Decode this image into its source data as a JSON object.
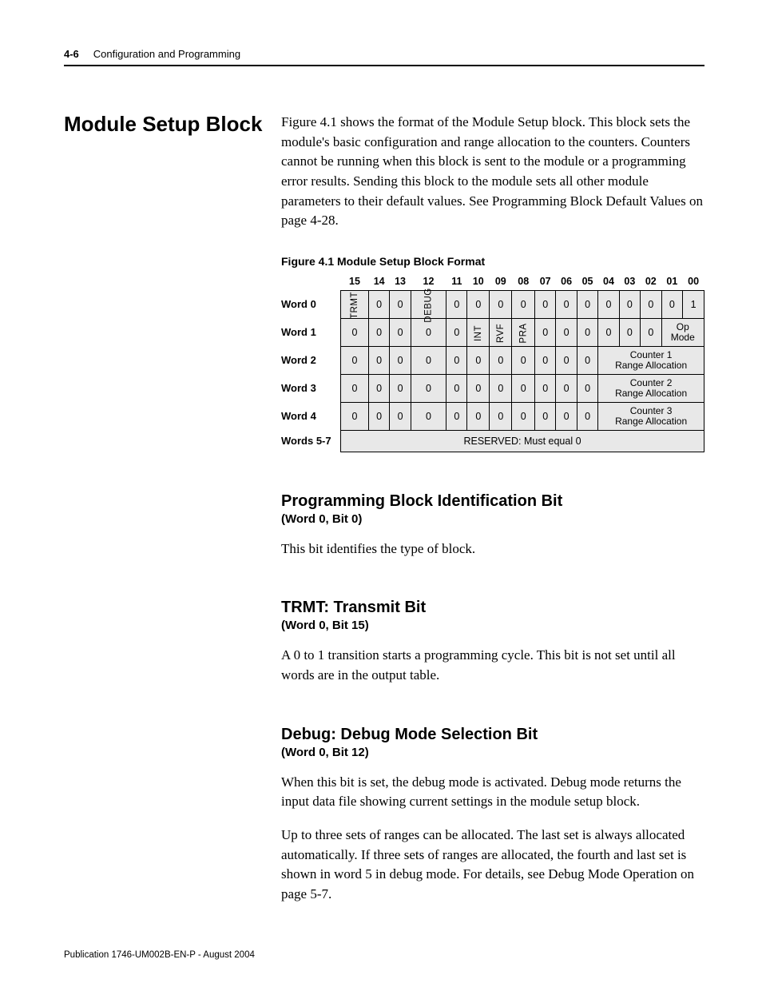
{
  "header": {
    "page_number": "4-6",
    "section_title": "Configuration and Programming"
  },
  "left_heading": "Module Setup Block",
  "intro_paragraph": "Figure 4.1 shows the format of the Module Setup block. This block sets the module's basic configuration and range allocation to the counters. Counters cannot be running when this block is sent to the module or a programming error results. Sending this block to the module sets all other module parameters to their default values. See Programming Block Default Values on page 4-28.",
  "figure_caption": "Figure 4.1 Module Setup Block Format",
  "bit_columns": [
    "15",
    "14",
    "13",
    "12",
    "11",
    "10",
    "09",
    "08",
    "07",
    "06",
    "05",
    "04",
    "03",
    "02",
    "01",
    "00"
  ],
  "rows": {
    "word0": {
      "label": "Word 0",
      "cells": [
        "TRMT",
        "0",
        "0",
        "DEBUG",
        "0",
        "0",
        "0",
        "0",
        "0",
        "0",
        "0",
        "0",
        "0",
        "0",
        "0",
        "1"
      ],
      "rotated": {
        "0": true,
        "3": true
      }
    },
    "word1": {
      "label": "Word 1",
      "cells": [
        "0",
        "0",
        "0",
        "0",
        "0",
        "INT",
        "RVF",
        "PRA",
        "0",
        "0",
        "0",
        "0",
        "0",
        "0"
      ],
      "rotated": {
        "5": true,
        "6": true,
        "7": true
      },
      "trailing_span": {
        "colspan": 2,
        "text_line1": "Op",
        "text_line2": "Mode"
      }
    },
    "word2": {
      "label": "Word 2",
      "cells": [
        "0",
        "0",
        "0",
        "0",
        "0",
        "0",
        "0",
        "0",
        "0",
        "0",
        "0"
      ],
      "trailing_span": {
        "colspan": 5,
        "text_line1": "Counter 1",
        "text_line2": "Range Allocation"
      }
    },
    "word3": {
      "label": "Word 3",
      "cells": [
        "0",
        "0",
        "0",
        "0",
        "0",
        "0",
        "0",
        "0",
        "0",
        "0",
        "0"
      ],
      "trailing_span": {
        "colspan": 5,
        "text_line1": "Counter 2",
        "text_line2": "Range Allocation"
      }
    },
    "word4": {
      "label": "Word 4",
      "cells": [
        "0",
        "0",
        "0",
        "0",
        "0",
        "0",
        "0",
        "0",
        "0",
        "0",
        "0"
      ],
      "trailing_span": {
        "colspan": 5,
        "text_line1": "Counter 3",
        "text_line2": "Range Allocation"
      }
    },
    "words57": {
      "label": "Words 5-7",
      "full_text": "RESERVED: Must equal 0"
    }
  },
  "sections": [
    {
      "title": "Programming Block Identification Bit",
      "subtitle": "(Word 0, Bit 0)",
      "body": "This bit identifies the type of block."
    },
    {
      "title": "TRMT: Transmit Bit",
      "subtitle": "(Word 0, Bit 15)",
      "body": "A 0 to 1 transition starts a programming cycle. This bit is not set until all words are in the output table."
    },
    {
      "title": "Debug: Debug Mode Selection Bit",
      "subtitle": "(Word 0, Bit 12)",
      "body": "When this bit is set, the debug mode is activated. Debug mode returns the input data file showing current settings in the module setup block.",
      "body2": "Up to three sets of ranges can be allocated. The last set is always allocated automatically. If three sets of ranges are allocated, the fourth and last set is shown in word 5 in debug mode. For details, see Debug Mode Operation on page 5-7."
    }
  ],
  "footer": "Publication 1746-UM002B-EN-P - August 2004"
}
